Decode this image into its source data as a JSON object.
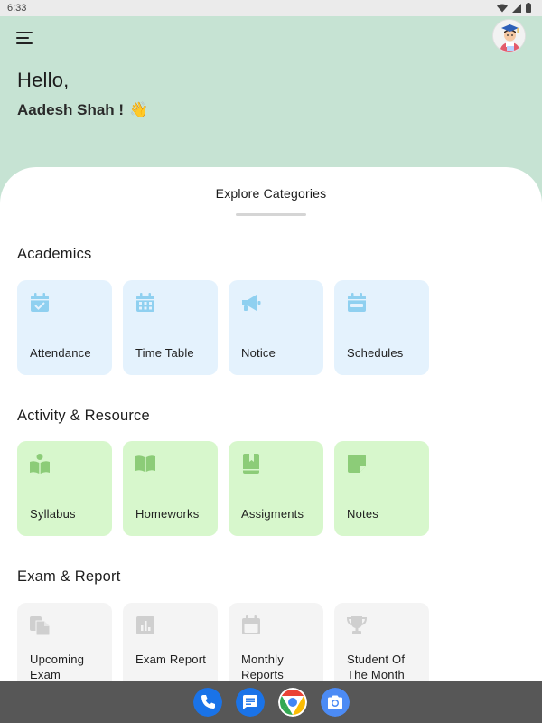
{
  "status_bar": {
    "time": "6:33"
  },
  "header": {
    "greeting": "Hello,",
    "user_name": "Aadesh Shah !",
    "wave_emoji": "👋"
  },
  "sheet": {
    "title": "Explore Categories"
  },
  "sections": [
    {
      "title": "Academics",
      "items": [
        {
          "label": "Attendance",
          "icon": "calendar-check-icon"
        },
        {
          "label": "Time Table",
          "icon": "calendar-grid-icon"
        },
        {
          "label": "Notice",
          "icon": "megaphone-icon"
        },
        {
          "label": "Schedules",
          "icon": "calendar-minus-icon"
        }
      ]
    },
    {
      "title": "Activity & Resource",
      "items": [
        {
          "label": "Syllabus",
          "icon": "reader-book-icon"
        },
        {
          "label": "Homeworks",
          "icon": "open-book-icon"
        },
        {
          "label": "Assigments",
          "icon": "bookmark-book-icon"
        },
        {
          "label": "Notes",
          "icon": "sticky-note-icon"
        }
      ]
    },
    {
      "title": "Exam & Report",
      "items": [
        {
          "label": "Upcoming Exam",
          "icon": "copy-files-icon"
        },
        {
          "label": "Exam Report",
          "icon": "bar-chart-icon"
        },
        {
          "label": "Monthly Reports",
          "icon": "calendar-blank-icon"
        },
        {
          "label": "Student Of The Month",
          "icon": "trophy-icon"
        }
      ]
    }
  ],
  "dock": [
    "phone-app-icon",
    "messages-app-icon",
    "chrome-app-icon",
    "camera-app-icon"
  ],
  "colors": {
    "header_bg": "#c6e3d3",
    "academics_card": "#e4f2fd",
    "academics_icon": "#8fd0f0",
    "activity_card": "#d7f7cc",
    "activity_icon": "#8ccc78",
    "exam_card": "#f4f4f4",
    "exam_icon": "#cfcfcf"
  }
}
